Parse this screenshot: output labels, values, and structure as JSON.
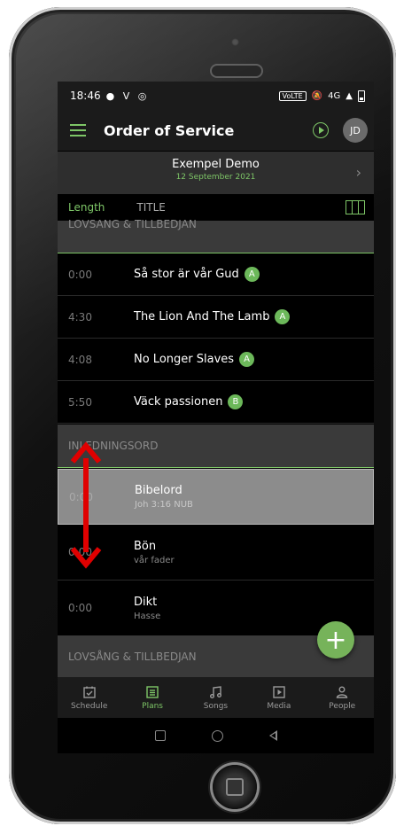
{
  "status_bar": {
    "time": "18:46",
    "notification_glyphs": "● V ◎",
    "volte": "VoLTE",
    "network": "4G"
  },
  "app_bar": {
    "title": "Order of Service",
    "avatar_initials": "JD",
    "accent_color": "#7ec667"
  },
  "plan": {
    "name": "Exempel Demo",
    "date": "12 September 2021"
  },
  "columns": {
    "length_label": "Length",
    "title_label": "TITLE"
  },
  "sections": [
    {
      "label": "LOVSANG & TILLBEDJAN"
    },
    {
      "label": "INLEDNINGSORD"
    },
    {
      "label": "LOVSÅNG & TILLBEDJAN"
    }
  ],
  "songs": [
    {
      "length": "0:00",
      "title": "Så stor är vår Gud",
      "key": "A"
    },
    {
      "length": "4:30",
      "title": "The Lion And The Lamb",
      "key": "A"
    },
    {
      "length": "4:08",
      "title": "No Longer Slaves",
      "key": "A"
    },
    {
      "length": "5:50",
      "title": "Väck passionen",
      "key": "B"
    }
  ],
  "items": [
    {
      "length": "0:00",
      "title": "Bibelord",
      "subtitle": "Joh 3:16 NUB",
      "selected": true
    },
    {
      "length": "0:00",
      "title": "Bön",
      "subtitle": "vår fader"
    },
    {
      "length": "0:00",
      "title": "Dikt",
      "subtitle": "Hasse"
    }
  ],
  "fab": {
    "icon": "plus-icon",
    "label": "+"
  },
  "tabs": [
    {
      "label": "Schedule",
      "icon": "calendar-check-icon"
    },
    {
      "label": "Plans",
      "icon": "list-icon",
      "active": true
    },
    {
      "label": "Songs",
      "icon": "music-note-icon"
    },
    {
      "label": "Media",
      "icon": "play-box-icon"
    },
    {
      "label": "People",
      "icon": "person-icon"
    }
  ]
}
